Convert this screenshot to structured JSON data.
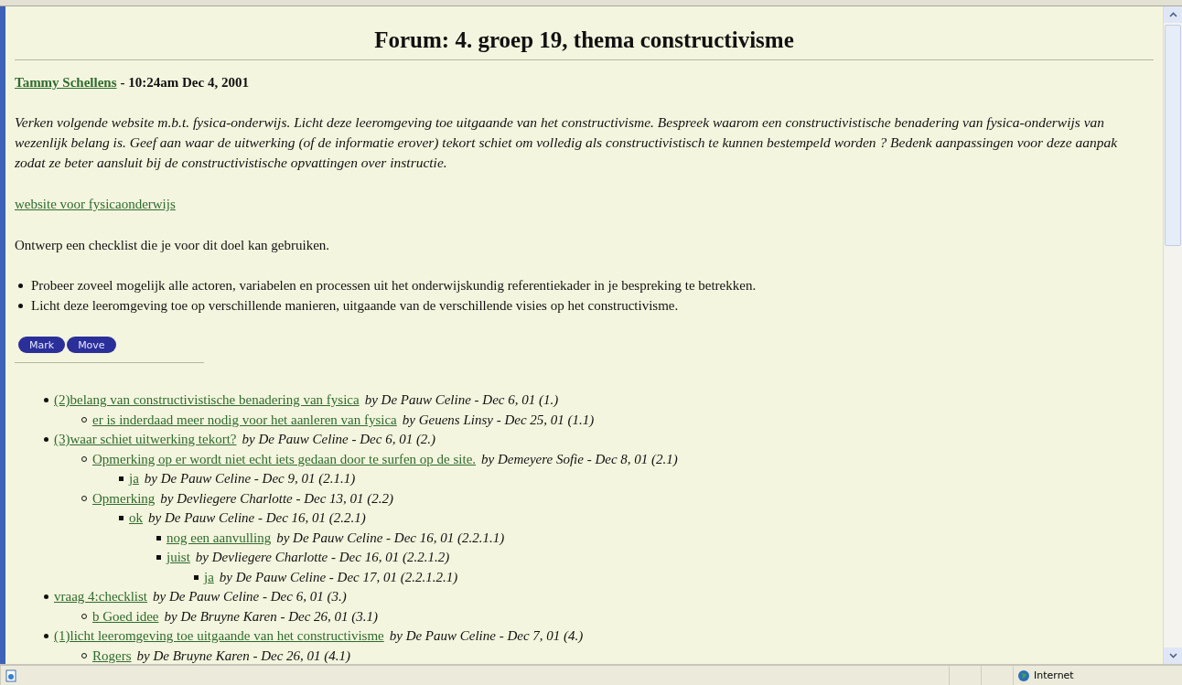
{
  "title": "Forum: 4. groep 19, thema constructivisme",
  "post": {
    "author": "Tammy Schellens",
    "meta": "- 10:24am Dec 4, 2001",
    "body": "Verken volgende website m.b.t. fysica-onderwijs. Licht deze leeromgeving toe uitgaande van het constructivisme. Bespreek waarom een constructivistische benadering van fysica-onderwijs van wezenlijk belang is. Geef aan waar de uitwerking (of de informatie erover) tekort schiet om volledig als constructivistisch te kunnen bestempeld worden ? Bedenk aanpassingen voor deze aanpak zodat ze beter aansluit bij de constructivistische opvattingen over instructie.",
    "link": "website voor fysicaonderwijs",
    "sentence": "Ontwerp een checklist die je voor dit doel kan gebruiken.",
    "bullets": [
      "Probeer zoveel mogelijk alle actoren, variabelen en processen uit het onderwijskundig referentiekader in je bespreking te betrekken.",
      "Licht deze leeromgeving toe op verschillende manieren, uitgaande van de verschillende visies op het constructivisme."
    ]
  },
  "buttons": [
    "Mark",
    "Move"
  ],
  "threads": [
    {
      "title": "(2)belang van constructivistische benadering van fysica",
      "info": "by De Pauw Celine - Dec 6, 01 (1.)",
      "children": [
        {
          "title": "er is inderdaad meer nodig voor het aanleren van fysica",
          "info": "by Geuens Linsy - Dec 25, 01 (1.1)"
        }
      ]
    },
    {
      "title": "(3)waar schiet uitwerking tekort?",
      "info": "by De Pauw Celine - Dec 6, 01 (2.)",
      "children": [
        {
          "title": "Opmerking op er wordt niet echt iets gedaan door te surfen op de site.",
          "info": "by Demeyere Sofie - Dec 8, 01 (2.1)",
          "children": [
            {
              "title": "ja",
              "info": "by De Pauw Celine - Dec 9, 01 (2.1.1)"
            }
          ]
        },
        {
          "title": "Opmerking",
          "info": "by Devliegere Charlotte - Dec 13, 01 (2.2)",
          "children": [
            {
              "title": "ok",
              "info": "by De Pauw Celine - Dec 16, 01 (2.2.1)",
              "children": [
                {
                  "title": "nog een aanvulling",
                  "info": "by De Pauw Celine - Dec 16, 01 (2.2.1.1)"
                },
                {
                  "title": "juist",
                  "info": "by Devliegere Charlotte - Dec 16, 01 (2.2.1.2)",
                  "children": [
                    {
                      "title": "ja",
                      "info": "by De Pauw Celine - Dec 17, 01 (2.2.1.2.1)"
                    }
                  ]
                }
              ]
            }
          ]
        }
      ]
    },
    {
      "title": "vraag 4:checklist",
      "info": "by De Pauw Celine - Dec 6, 01 (3.)",
      "children": [
        {
          "title": "b Goed idee",
          "info": "by De Bruyne Karen - Dec 26, 01 (3.1)"
        }
      ]
    },
    {
      "title": "(1)licht leeromgeving toe uitgaande van het constructivisme",
      "info": "by De Pauw Celine - Dec 7, 01 (4.)",
      "children": [
        {
          "title": "Rogers",
          "info": "by De Bruyne Karen - Dec 26, 01 (4.1)"
        }
      ]
    }
  ],
  "status_bar": {
    "zone": "Internet"
  }
}
